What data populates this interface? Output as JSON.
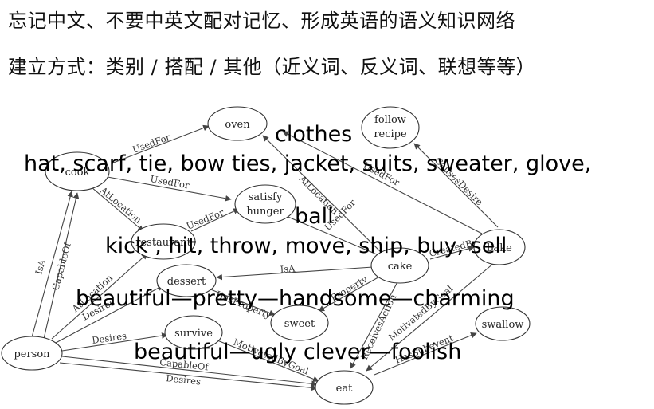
{
  "headings": {
    "line1": "忘记中文、不要中英文配对记忆、形成英语的语义知识网络",
    "line2": "建立方式：类别 / 搭配 / 其他（近义词、反义词、联想等等）"
  },
  "network": {
    "nodes": {
      "oven": "oven",
      "follow_recipe_1": "follow",
      "follow_recipe_2": "recipe",
      "cook": "cook",
      "satisfy_hunger_1": "satisfy",
      "satisfy_hunger_2": "hunger",
      "restaurant": "restaurant",
      "bake": "bake",
      "cake": "cake",
      "dessert": "dessert",
      "sweet": "sweet",
      "swallow": "swallow",
      "survive": "survive",
      "person": "person",
      "eat": "eat"
    },
    "edges": {
      "cook_oven": "UsedFor",
      "cook_satisfy": "UsedFor",
      "cook_restaurant": "AtLocation",
      "restaurant_satisfy": "UsedFor",
      "cake_oven_loc": "AtLocation",
      "bake_oven": "UsedFor",
      "bake_recipe": "CausesDesire",
      "cake_satisfy": "UsedFor",
      "cake_bake": "CreatedBy",
      "cake_dessert": "IsA",
      "dessert_sweet": "HasProperty",
      "cake_sweet": "Property",
      "person_cook_isa": "IsA",
      "person_cook_capable": "CapableOf",
      "person_restaurant": "AtLocation",
      "person_dessert": "Desires",
      "person_survive": "Desires",
      "survive_eat": "MotivatedByGoal",
      "person_eat_capable": "CapableOf",
      "person_eat_desires": "Desires",
      "cake_eat": "ReceivesAction",
      "bake_eat": "MotivatedByGoal",
      "eat_swallow": "HasSubevent"
    }
  },
  "overlays": {
    "clothes": "clothes",
    "clothes_items": "hat, scarf, tie, bow ties, jacket, suits, sweater, glove,",
    "ball": "ball",
    "ball_verbs": "kick , hit, throw, move, ship, buy, sell",
    "synonyms": "beautiful—pretty—handsome—charming",
    "antonyms": "beautiful—ugly  clever—foolish"
  }
}
